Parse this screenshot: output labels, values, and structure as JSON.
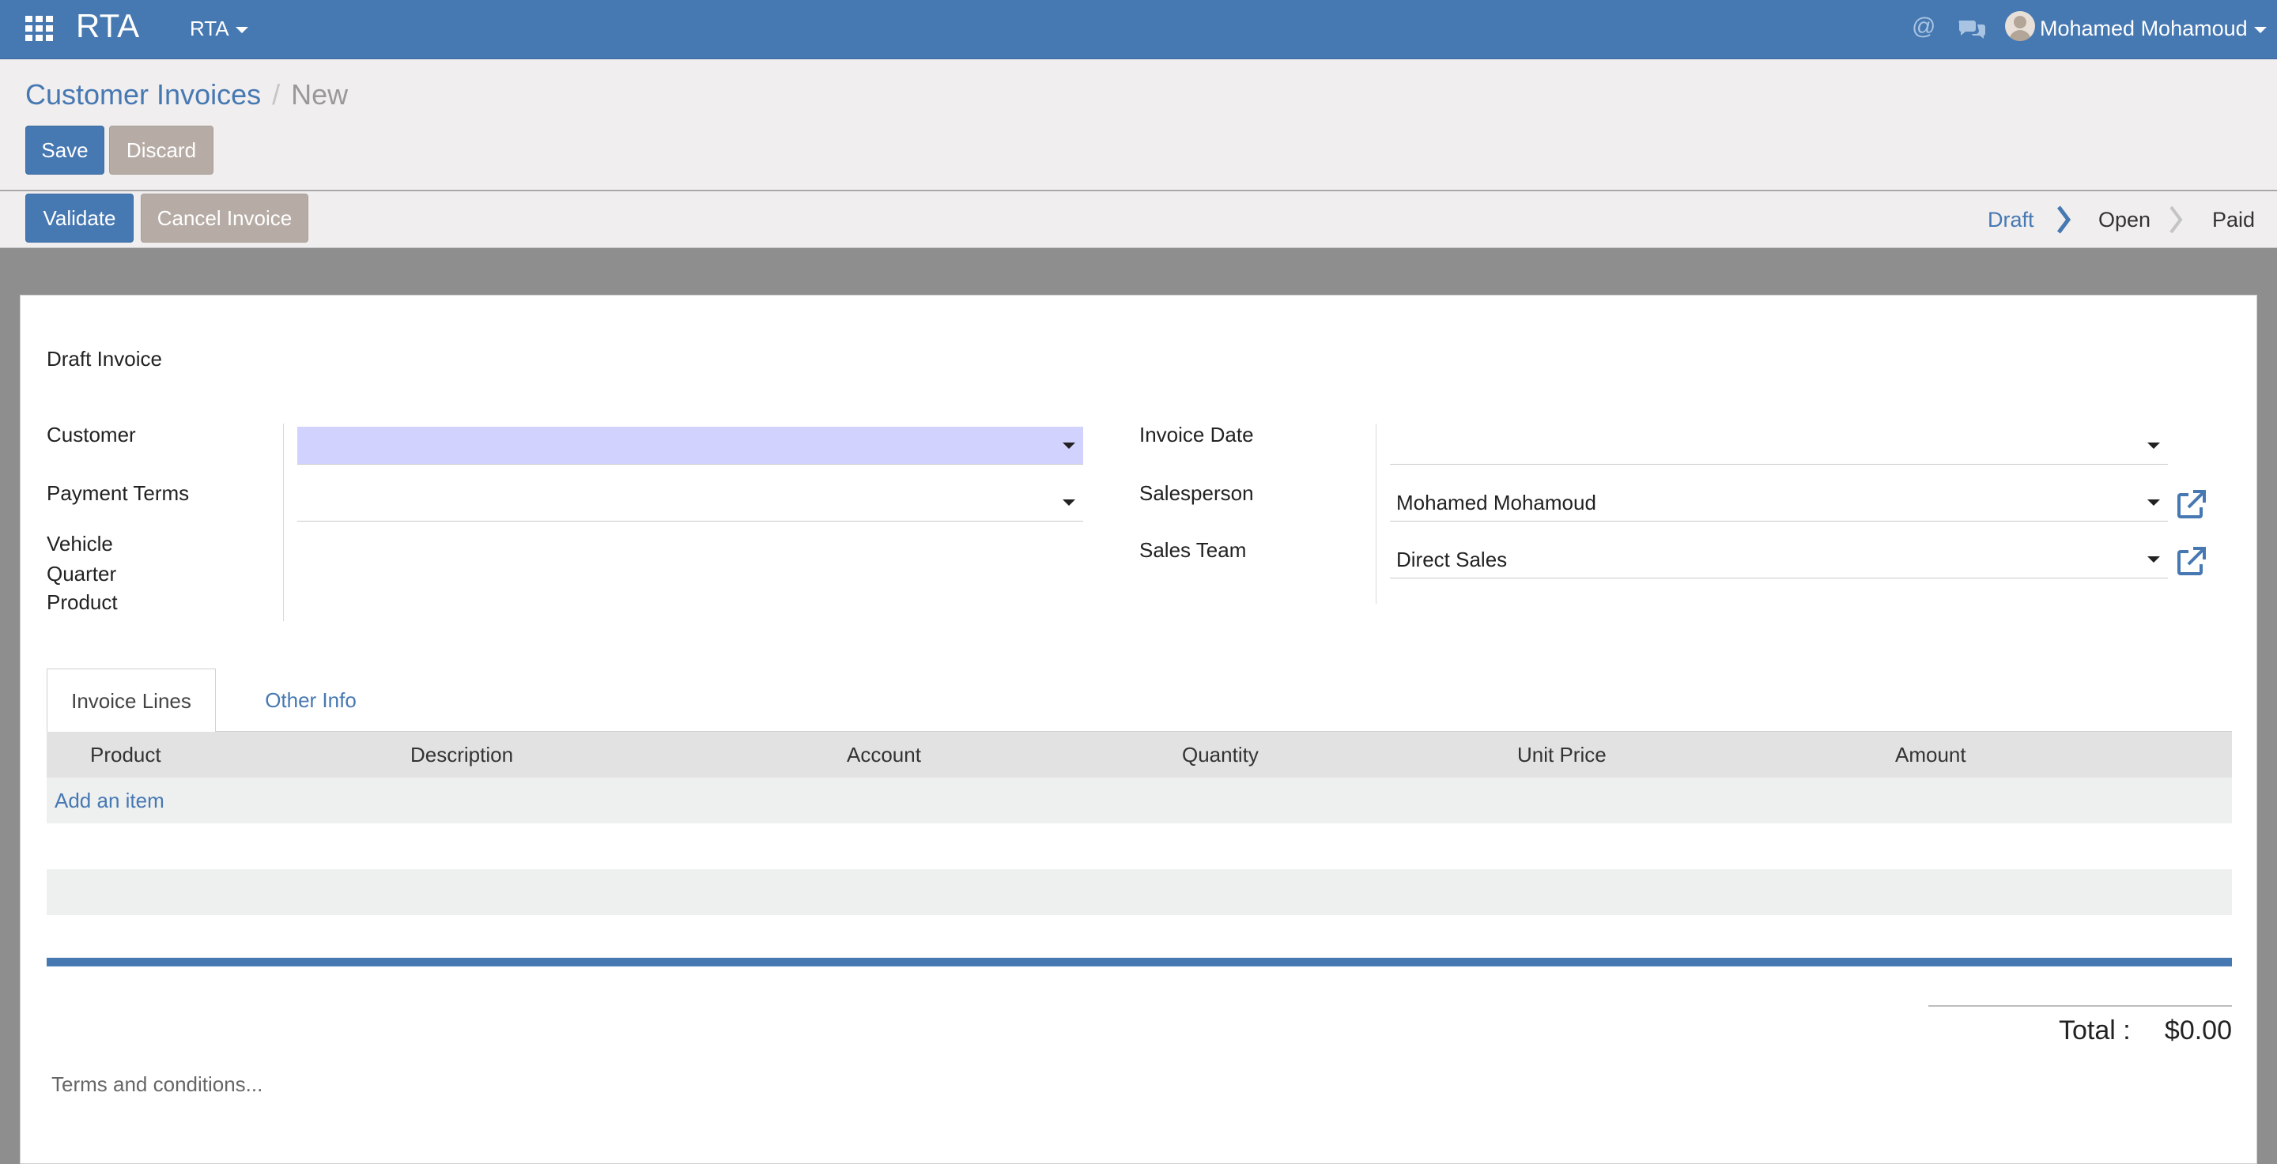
{
  "navbar": {
    "brand": "RTA",
    "company": "RTA",
    "at_icon": "@",
    "user_name": "Mohamed Mohamoud"
  },
  "control_panel": {
    "breadcrumb": [
      "Customer Invoices",
      "New"
    ],
    "save_label": "Save",
    "discard_label": "Discard"
  },
  "statusbar": {
    "validate_label": "Validate",
    "cancel_label": "Cancel Invoice",
    "stages": [
      "Draft",
      "Open",
      "Paid"
    ],
    "active_stage": "Draft"
  },
  "form": {
    "title": "Draft Invoice",
    "left": {
      "customer_label": "Customer",
      "customer_value": "",
      "payment_terms_label": "Payment Terms",
      "payment_terms_value": "",
      "vehicle_label": "Vehicle",
      "quarter_label": "Quarter",
      "product_label": "Product"
    },
    "right": {
      "invoice_date_label": "Invoice Date",
      "invoice_date_value": "",
      "salesperson_label": "Salesperson",
      "salesperson_value": "Mohamed Mohamoud",
      "sales_team_label": "Sales Team",
      "sales_team_value": "Direct Sales"
    }
  },
  "notebook": {
    "tabs": [
      "Invoice Lines",
      "Other Info"
    ],
    "columns": [
      "Product",
      "Description",
      "Account",
      "Quantity",
      "Unit Price",
      "Amount"
    ],
    "add_item_label": "Add an item"
  },
  "totals": {
    "label": "Total :",
    "value": "$0.00"
  },
  "terms_placeholder": "Terms and conditions...",
  "colors": {
    "primary": "#4678b2",
    "secondary_button": "#b6aca5",
    "required_field": "#d2d2ff",
    "backdrop": "#8e8e8e"
  },
  "icons": [
    "apps-grid-icon",
    "at-sign-icon",
    "chat-icon",
    "user-avatar-icon",
    "caret-down-icon",
    "chevron-right-icon",
    "external-link-icon"
  ]
}
